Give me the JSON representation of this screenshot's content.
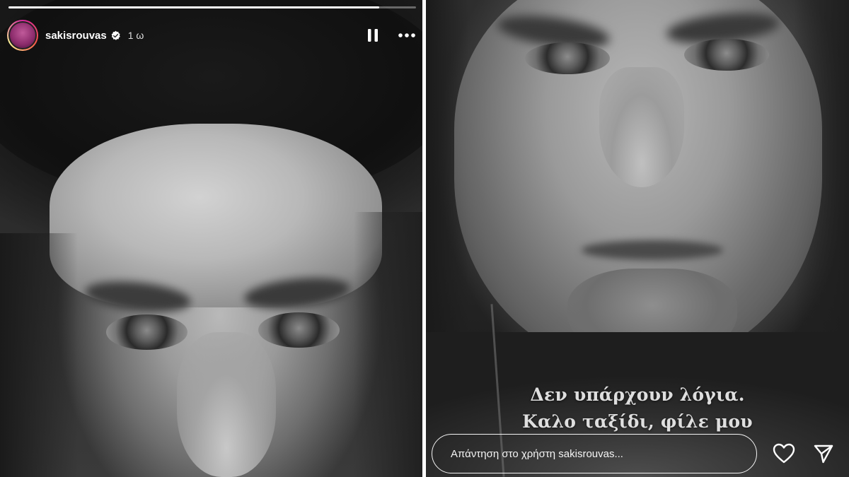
{
  "story": {
    "progress_fraction": 0.91,
    "author": {
      "username": "sakisrouvas",
      "verified": true,
      "timestamp": "1 ω"
    },
    "controls": {
      "pause_icon": "pause-icon",
      "more_icon": "more-options-icon"
    }
  },
  "right_story": {
    "caption_lines": [
      "Δεν υπάρχουν λόγια.",
      "Καλο ταξίδι, φίλε μου"
    ],
    "reply": {
      "placeholder": "Απάντηση στο χρήστη sakisrouvas...",
      "value": ""
    },
    "actions": {
      "like_icon": "heart-icon",
      "share_icon": "send-icon"
    }
  },
  "colors": {
    "progress_fill": "#ffffff",
    "verified_badge": "#ffffff"
  }
}
